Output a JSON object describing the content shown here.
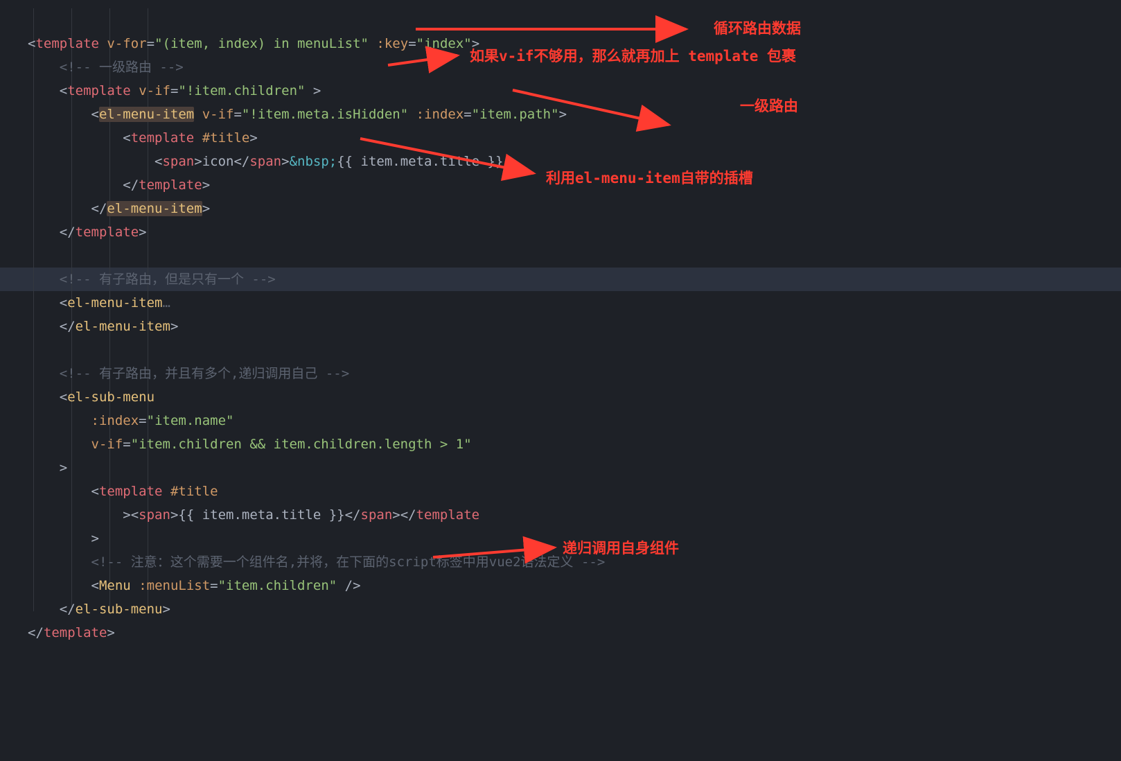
{
  "annotations": {
    "a1": "循环路由数据",
    "a2": "如果v-if不够用，那么就再加上 template 包裹",
    "a3": "一级路由",
    "a4": "利用el-menu-item自带的插槽",
    "a5": "递归调用自身组件"
  },
  "code": {
    "l01": {
      "vfor": "(item, index) in menuList",
      "key": "index"
    },
    "l02": "<!-- 一级路由 -->",
    "l03": {
      "vif": "!item.children"
    },
    "l04": {
      "vif": "!item.meta.isHidden",
      "index": "item.path"
    },
    "l05": "#title",
    "l06": {
      "icon": "icon",
      "ent": "&nbsp;",
      "expr": "{{ item.meta.title }}"
    },
    "l07": "</template>",
    "l08": "</el-menu-item>",
    "l09": "</template>",
    "l10": "",
    "l11": "<!-- 有子路由，但是只有一个 -->",
    "l12": "<el-menu-item…",
    "l13": "</el-menu-item>",
    "l14": "",
    "l15": "<!-- 有子路由，并且有多个,递归调用自己 -->",
    "l16": "<el-sub-menu",
    "l17": {
      "index": "item.name"
    },
    "l18": {
      "vif": "item.children && item.children.length > 1"
    },
    "l19": ">",
    "l20": "#title",
    "l21": {
      "expr": "{{ item.meta.title }}"
    },
    "l22": ">",
    "l23": "<!-- 注意：这个需要一个组件名,并将，在下面的script标签中用vue2语法定义 -->",
    "l24": {
      "attr": "item.children"
    },
    "l25": "</el-sub-menu>",
    "l26": "</template>"
  }
}
